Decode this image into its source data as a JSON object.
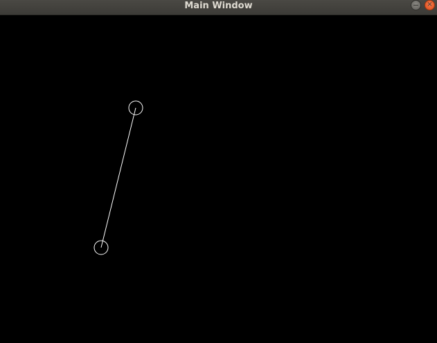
{
  "window": {
    "title": "Main Window"
  },
  "controls": {
    "minimize_icon": "minimize-icon",
    "close_icon": "close-icon",
    "close_glyph": "×"
  },
  "colors": {
    "titlebar": "#3c3b37",
    "title_text": "#dfdbd2",
    "canvas_background": "#000000",
    "stroke": "#ffffff",
    "close_button": "#e95420"
  }
}
